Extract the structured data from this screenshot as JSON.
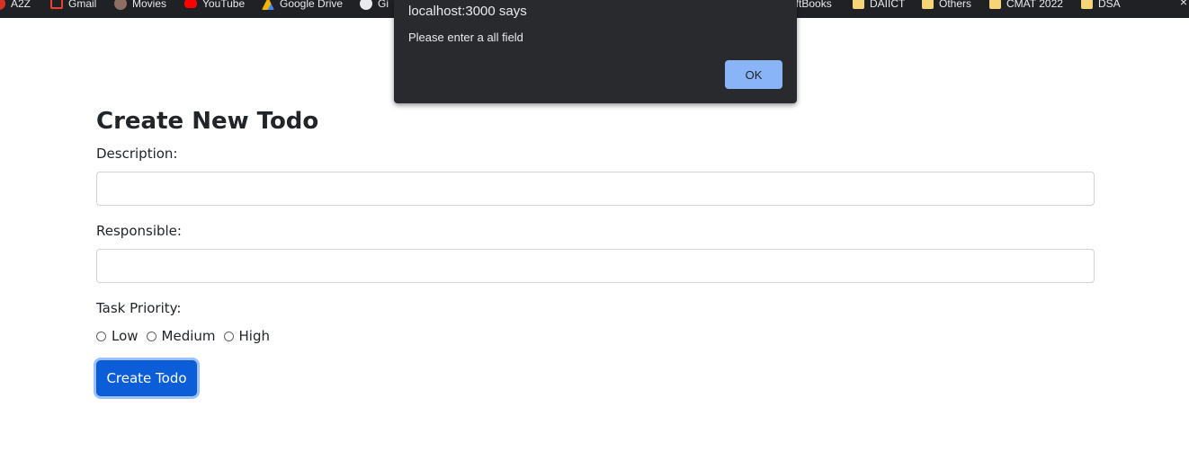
{
  "bookmarks": [
    {
      "label": "A2Z",
      "icon": "red-circle-icon"
    },
    {
      "label": "Gmail",
      "icon": "gmail-icon"
    },
    {
      "label": "Movies",
      "icon": "movies-icon"
    },
    {
      "label": "YouTube",
      "icon": "youtube-icon"
    },
    {
      "label": "Google Drive",
      "icon": "google-drive-icon"
    },
    {
      "label": "Gi",
      "icon": "github-icon"
    },
    {
      "label": "oftBooks",
      "icon": ""
    },
    {
      "label": "DAIICT",
      "icon": "folder-icon"
    },
    {
      "label": "Others",
      "icon": "folder-icon"
    },
    {
      "label": "CMAT 2022",
      "icon": "folder-icon"
    },
    {
      "label": "DSA",
      "icon": "folder-icon"
    }
  ],
  "dialog": {
    "title": "localhost:3000 says",
    "message": "Please enter a all field",
    "ok_label": "OK"
  },
  "form": {
    "title": "Create New Todo",
    "description_label": "Description:",
    "description_value": "",
    "responsible_label": "Responsible:",
    "responsible_value": "",
    "priority_label": "Task Priority:",
    "priorities": [
      "Low",
      "Medium",
      "High"
    ],
    "submit_label": "Create Todo"
  },
  "colors": {
    "primary_button": "#0b5ed7",
    "dialog_bg": "#292a2d",
    "dialog_button": "#8ab4f8",
    "bookmarks_bar": "#202124"
  }
}
